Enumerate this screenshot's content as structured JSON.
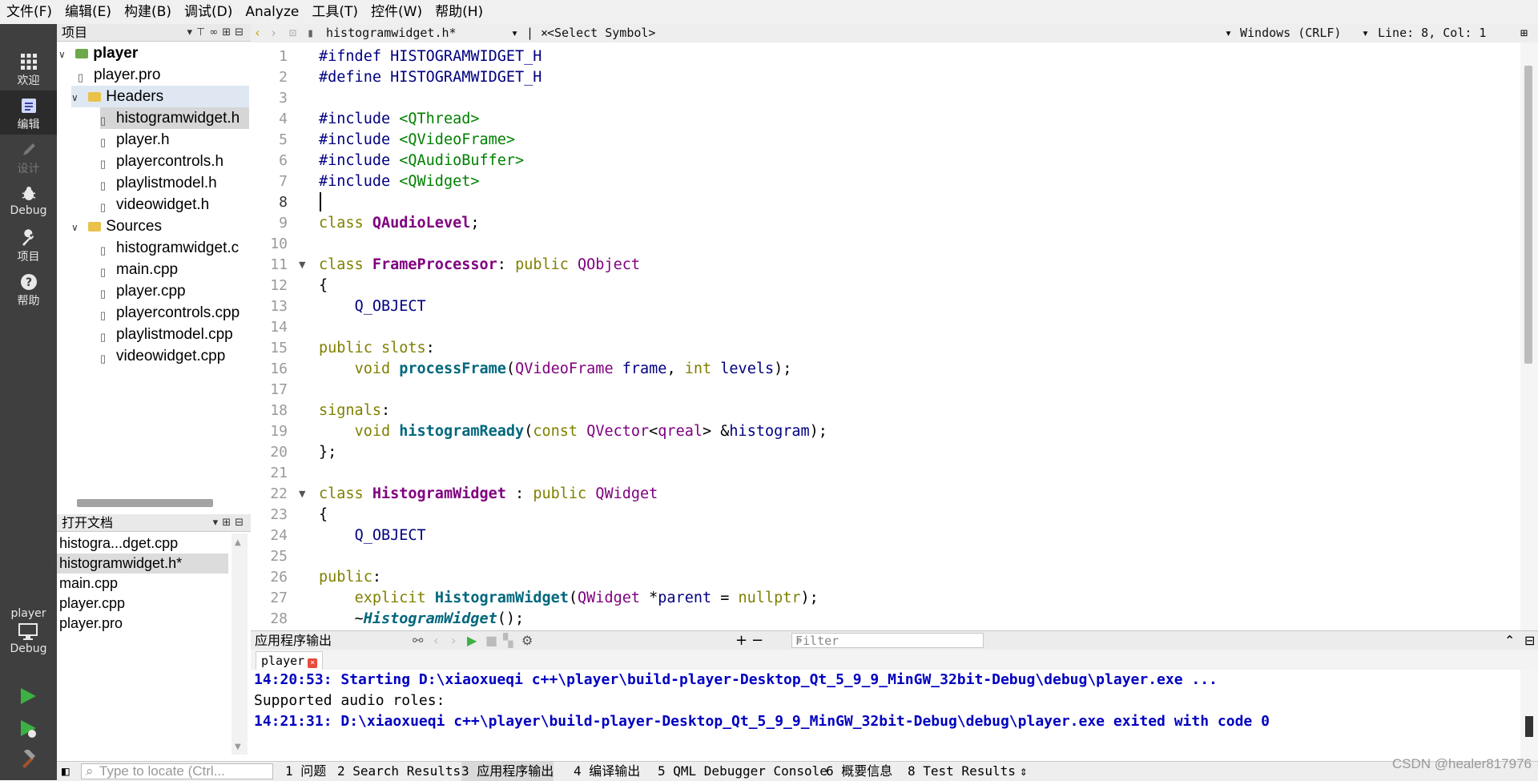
{
  "menu": [
    "文件(F)",
    "编辑(E)",
    "构建(B)",
    "调试(D)",
    "Analyze",
    "工具(T)",
    "控件(W)",
    "帮助(H)"
  ],
  "modes": [
    {
      "label": "欢迎",
      "icon": "grid-icon"
    },
    {
      "label": "编辑",
      "icon": "edit-icon"
    },
    {
      "label": "设计",
      "icon": "pen-icon"
    },
    {
      "label": "Debug",
      "icon": "bug-icon"
    },
    {
      "label": "项目",
      "icon": "wrench-icon"
    },
    {
      "label": "帮助",
      "icon": "help-icon"
    }
  ],
  "target": {
    "project": "player",
    "config": "Debug"
  },
  "project_panel": {
    "title": "项目"
  },
  "tree": {
    "root": "player",
    "pro": "player.pro",
    "headers_label": "Headers",
    "headers": [
      "histogramwidget.h",
      "player.h",
      "playercontrols.h",
      "playlistmodel.h",
      "videowidget.h"
    ],
    "sources_label": "Sources",
    "sources": [
      "histogramwidget.c",
      "main.cpp",
      "player.cpp",
      "playercontrols.cpp",
      "playlistmodel.cpp",
      "videowidget.cpp"
    ]
  },
  "open_docs": {
    "title": "打开文档",
    "items": [
      "histogra...dget.cpp",
      "histogramwidget.h*",
      "main.cpp",
      "player.cpp",
      "player.pro"
    ]
  },
  "editor_toolbar": {
    "file": "histogramwidget.h*",
    "symbol": "<Select Symbol>",
    "encoding": "Windows (CRLF)",
    "position": "Line: 8, Col: 1"
  },
  "code": {
    "line_numbers": [
      "1",
      "2",
      "3",
      "4",
      "5",
      "6",
      "7",
      "8",
      "9",
      "10",
      "11",
      "12",
      "13",
      "14",
      "15",
      "16",
      "17",
      "18",
      "19",
      "20",
      "21",
      "22",
      "23",
      "24",
      "25",
      "26",
      "27",
      "28"
    ],
    "current_line": "8"
  },
  "output": {
    "title": "应用程序输出",
    "filter_placeholder": "Filter",
    "tab": "player",
    "lines": [
      "14:20:53: Starting D:\\xiaoxueqi c++\\player\\build-player-Desktop_Qt_5_9_9_MinGW_32bit-Debug\\debug\\player.exe ...",
      "Supported audio roles:",
      "14:21:31: D:\\xiaoxueqi c++\\player\\build-player-Desktop_Qt_5_9_9_MinGW_32bit-Debug\\debug\\player.exe exited with code 0"
    ]
  },
  "status": {
    "locate_placeholder": "Type to locate (Ctrl...",
    "tabs": [
      "1 问题",
      "2 Search Results",
      "3 应用程序输出",
      "4 编译输出",
      "5 QML Debugger Console",
      "6 概要信息",
      "8 Test Results"
    ]
  },
  "watermark": "CSDN @healer817976"
}
